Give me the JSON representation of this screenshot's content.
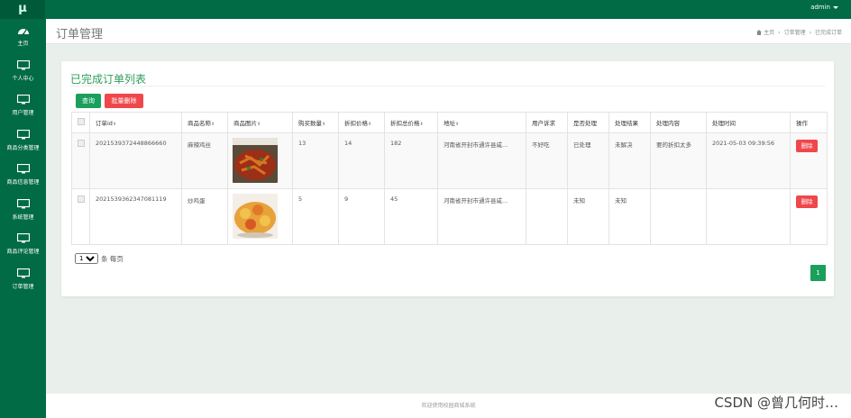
{
  "app": {
    "logo": "μ",
    "user": "admin"
  },
  "sidebar": {
    "items": [
      {
        "icon": "dashboard-icon",
        "label": "主页"
      },
      {
        "icon": "monitor-icon",
        "label": "个人中心"
      },
      {
        "icon": "monitor-icon",
        "label": "用户管理"
      },
      {
        "icon": "monitor-icon",
        "label": "商品分类管理"
      },
      {
        "icon": "monitor-icon",
        "label": "商品信息管理"
      },
      {
        "icon": "monitor-icon",
        "label": "系统管理"
      },
      {
        "icon": "monitor-icon",
        "label": "商品评论管理"
      },
      {
        "icon": "monitor-icon",
        "label": "订单管理"
      }
    ]
  },
  "header": {
    "title": "订单管理",
    "breadcrumb": [
      "主页",
      "订单管理",
      "已完成订单"
    ]
  },
  "card": {
    "title": "已完成订单列表",
    "query_label": "查询",
    "batch_delete_label": "批量删除"
  },
  "table": {
    "columns": [
      "订单id",
      "商品名称",
      "商品图片",
      "购买数量",
      "折扣价格",
      "折扣总价格",
      "地址",
      "用户诉求",
      "是否处理",
      "处理结果",
      "处理内容",
      "处理时间",
      "操作"
    ],
    "rows": [
      {
        "order_id": "2021539372448866660",
        "product_name": "麻辣鸡丝",
        "quantity": "13",
        "discount_price": "14",
        "discount_total": "182",
        "address": "河南省开封市通许县咸...",
        "user_request": "不好吃",
        "processed": "已处理",
        "result": "未解决",
        "content": "要的折扣太多",
        "time": "2021-05-03 09:39:56",
        "action": "删除"
      },
      {
        "order_id": "2021539362347081119",
        "product_name": "炒鸡蛋",
        "quantity": "5",
        "discount_price": "9",
        "discount_total": "45",
        "address": "河南省开封市通许县咸...",
        "user_request": "",
        "processed": "未知",
        "result": "未知",
        "content": "",
        "time": "",
        "action": "删除"
      }
    ]
  },
  "pagination": {
    "page_size": "10",
    "per_page_label": "条 每页",
    "current_page": "1"
  },
  "footer": {
    "text": "欢迎使用校园商城系统"
  },
  "watermark": "CSDN @曾几何时…",
  "colors": {
    "primary": "#006b45",
    "accent": "#1a9f5c",
    "danger": "#f0474b",
    "title": "#2e9b5c"
  }
}
